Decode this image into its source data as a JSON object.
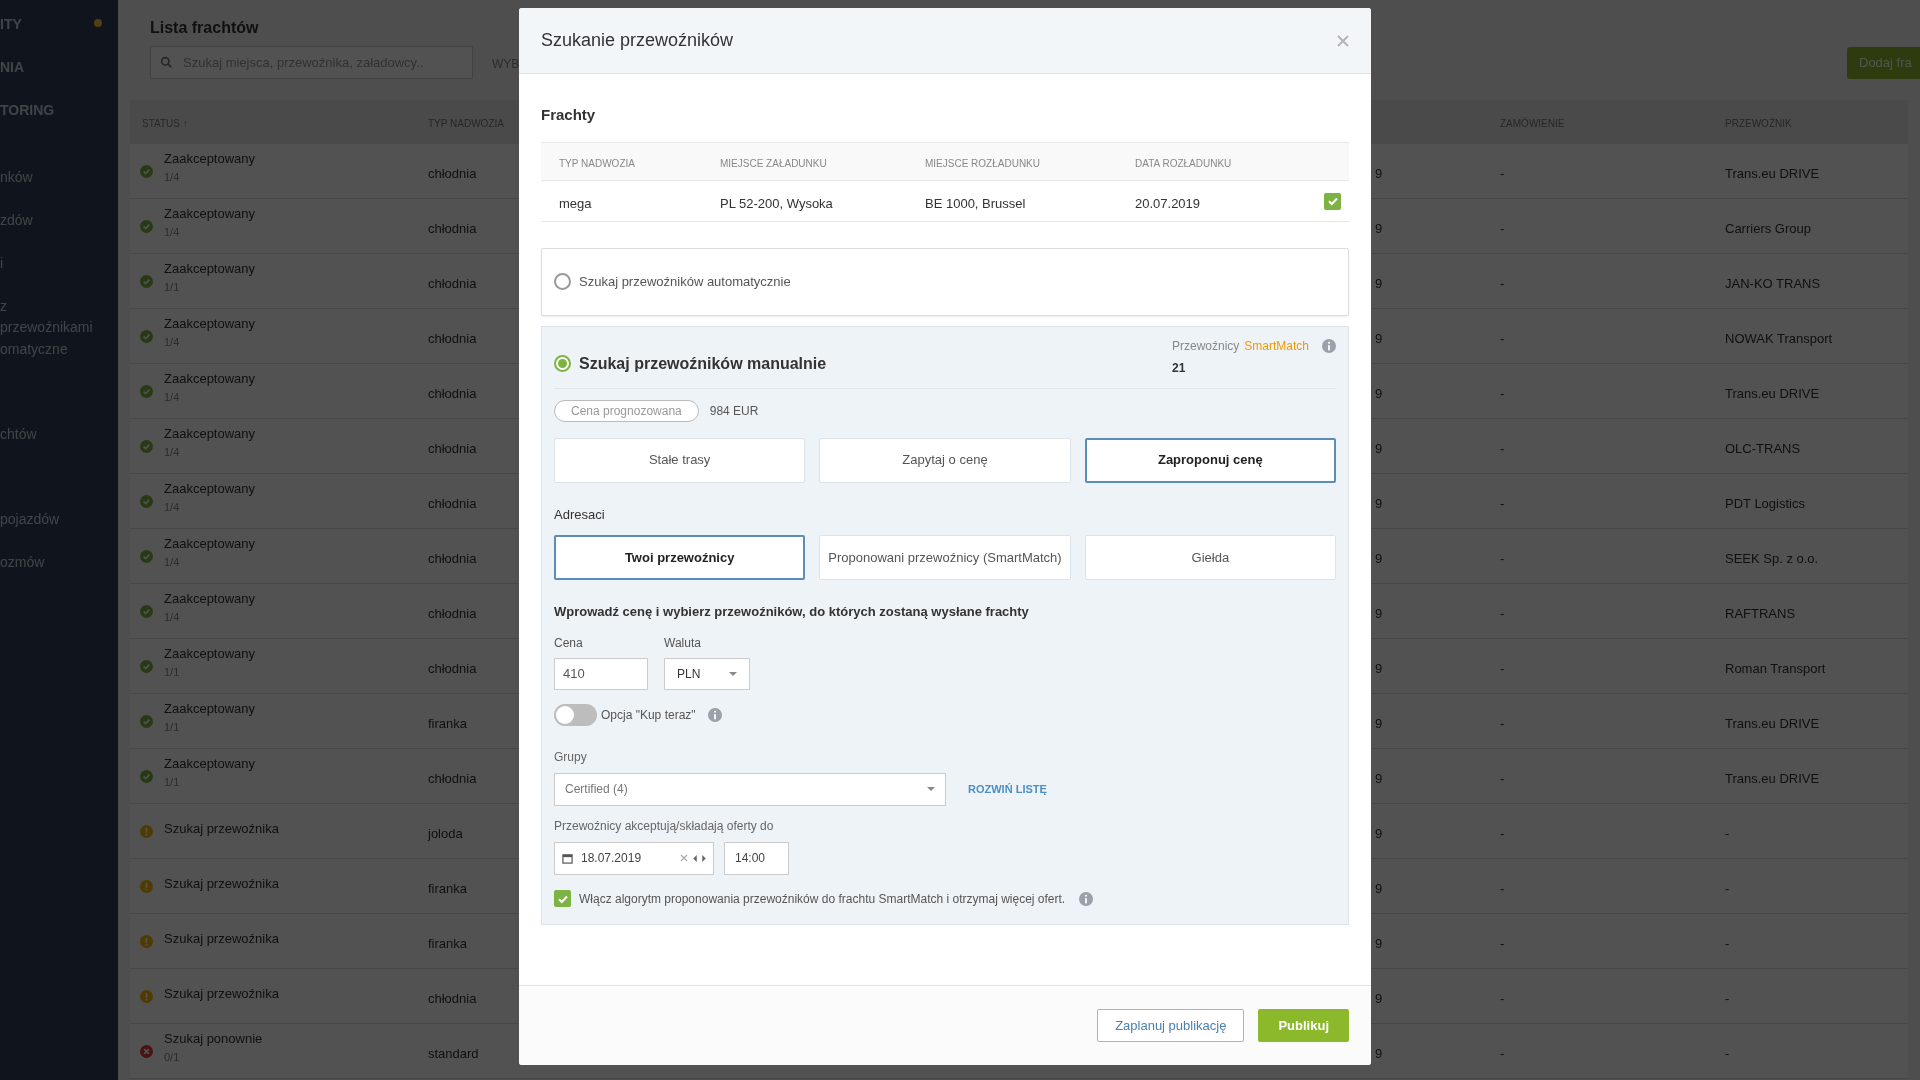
{
  "sidebar": {
    "items": [
      {
        "label": "ITY",
        "dot": true
      },
      {
        "label": "NIA",
        "dot": false
      },
      {
        "label": "TORING",
        "dot": false
      },
      {
        "label": "nków",
        "dot": false
      },
      {
        "label": "zdów",
        "dot": false
      },
      {
        "label": "i",
        "dot": false
      },
      {
        "label": "z przewoźnikami",
        "dot": false
      },
      {
        "label": "omatyczne",
        "dot": false
      },
      {
        "label": "chtów",
        "dot": false
      },
      {
        "label": "pojazdów",
        "dot": false
      },
      {
        "label": "ozmów",
        "dot": false
      }
    ]
  },
  "page": {
    "title": "Lista frachtów",
    "search": {
      "placeholder": "Szukaj miejsca, przewoźnika, załadowcy.."
    },
    "filter_label": "WYB",
    "add_button": "Dodaj fra"
  },
  "table": {
    "columns": [
      "STATUS ↑",
      "TYP NADWOZIA",
      "ZAMÓWIENIE",
      "PRZEWOŹNIK"
    ],
    "rows": [
      {
        "kind": "accepted",
        "status": "Zaakceptowany",
        "count": "1/4",
        "body": "chłodnia",
        "column_3": "9",
        "order": "-",
        "carrier": "Trans.eu DRIVE"
      },
      {
        "kind": "accepted",
        "status": "Zaakceptowany",
        "count": "1/4",
        "body": "chłodnia",
        "column_3": "9",
        "order": "-",
        "carrier": "Carriers Group"
      },
      {
        "kind": "accepted",
        "status": "Zaakceptowany",
        "count": "1/1",
        "body": "chłodnia",
        "column_3": "9",
        "order": "-",
        "carrier": "JAN-KO TRANS"
      },
      {
        "kind": "accepted",
        "status": "Zaakceptowany",
        "count": "1/4",
        "body": "chłodnia",
        "column_3": "9",
        "order": "-",
        "carrier": "NOWAK Transport"
      },
      {
        "kind": "accepted",
        "status": "Zaakceptowany",
        "count": "1/4",
        "body": "chłodnia",
        "column_3": "9",
        "order": "-",
        "carrier": "Trans.eu DRIVE"
      },
      {
        "kind": "accepted",
        "status": "Zaakceptowany",
        "count": "1/4",
        "body": "chłodnia",
        "column_3": "9",
        "order": "-",
        "carrier": "OLC-TRANS"
      },
      {
        "kind": "accepted",
        "status": "Zaakceptowany",
        "count": "1/4",
        "body": "chłodnia",
        "column_3": "9",
        "order": "-",
        "carrier": "PDT Logistics"
      },
      {
        "kind": "accepted",
        "status": "Zaakceptowany",
        "count": "1/4",
        "body": "chłodnia",
        "column_3": "9",
        "order": "-",
        "carrier": "SEEK Sp. z o.o."
      },
      {
        "kind": "accepted",
        "status": "Zaakceptowany",
        "count": "1/4",
        "body": "chłodnia",
        "column_3": "9",
        "order": "-",
        "carrier": "RAFTRANS"
      },
      {
        "kind": "accepted",
        "status": "Zaakceptowany",
        "count": "1/1",
        "body": "chłodnia",
        "column_3": "9",
        "order": "-",
        "carrier": "Roman Transport"
      },
      {
        "kind": "accepted",
        "status": "Zaakceptowany",
        "count": "1/1",
        "body": "firanka",
        "column_3": "9",
        "order": "-",
        "carrier": "Trans.eu DRIVE"
      },
      {
        "kind": "accepted",
        "status": "Zaakceptowany",
        "count": "1/1",
        "body": "chłodnia",
        "column_3": "9",
        "order": "-",
        "carrier": "Trans.eu DRIVE"
      },
      {
        "kind": "searching",
        "status": "Szukaj przewoźnika",
        "body": "joloda",
        "column_3": "9",
        "order": "-",
        "carrier": "-"
      },
      {
        "kind": "searching",
        "status": "Szukaj przewoźnika",
        "body": "firanka",
        "column_3": "9",
        "order": "-",
        "carrier": "-"
      },
      {
        "kind": "searching",
        "status": "Szukaj przewoźnika",
        "body": "firanka",
        "column_3": "9",
        "order": "-",
        "carrier": "-"
      },
      {
        "kind": "searching",
        "status": "Szukaj przewoźnika",
        "body": "chłodnia",
        "column_3": "9",
        "order": "-",
        "carrier": "-"
      },
      {
        "kind": "retry",
        "status": "Szukaj ponownie",
        "count": "0/1",
        "body": "standard",
        "column_3": "9",
        "order": "-",
        "carrier": "-"
      }
    ]
  },
  "modal": {
    "title": "Szukanie przewoźników",
    "freights": {
      "title": "Frachty",
      "columns": [
        "TYP NADWOZIA",
        "MIEJSCE ZAŁADUNKU",
        "MIEJSCE ROZŁADUNKU",
        "DATA ROZŁADUNKU"
      ],
      "rows": [
        {
          "cells": [
            "mega",
            "PL 52-200, Wysoka",
            "BE 1000, Brussel",
            "20.07.2019"
          ],
          "checked": true
        }
      ]
    },
    "search_modes": [
      {
        "label": "Szukaj przewoźników automatycznie",
        "selected": false
      },
      {
        "label": "Szukaj przewoźników manualnie",
        "selected": true
      }
    ],
    "smartmatch": {
      "label": "Przewoźnicy",
      "brand": "SmartMatch",
      "count": "21"
    },
    "forecast": {
      "label": "Cena prognozowana",
      "value": "984 EUR"
    },
    "offer_types": [
      {
        "label": "Stałe trasy",
        "selected": false
      },
      {
        "label": "Zapytaj o cenę",
        "selected": false
      },
      {
        "label": "Zaproponuj cenę",
        "selected": true
      }
    ],
    "recipients": {
      "title": "Adresaci",
      "options": [
        {
          "label": "Twoi przewoźnicy",
          "selected": true
        },
        {
          "label": "Proponowani przewoźnicy (SmartMatch)",
          "selected": false
        },
        {
          "label": "Giełda",
          "selected": false
        }
      ]
    },
    "instruction": "Wprowadź cenę i wybierz przewoźników, do których zostaną wysłane frachty",
    "price": {
      "label": "Cena",
      "value": "410"
    },
    "currency": {
      "label": "Waluta",
      "value": "PLN"
    },
    "buy_now": {
      "label": "Opcja \"Kup teraz\"",
      "on": false
    },
    "groups": {
      "label": "Grupy",
      "value": "Certified (4)",
      "link": "ROZWIŃ LISTĘ"
    },
    "deadline": {
      "label": "Przewoźnicy akceptują/składają oferty do",
      "date": "18.07.2019",
      "time": "14:00"
    },
    "algorithm": {
      "label": "Włącz algorytm proponowania przewoźników do frachtu SmartMatch i otrzymaj więcej ofert.",
      "checked": true
    },
    "buttons": [
      {
        "label": "Zaplanuj publikację",
        "kind": "secondary"
      },
      {
        "label": "Publikuj",
        "kind": "primary"
      }
    ]
  }
}
